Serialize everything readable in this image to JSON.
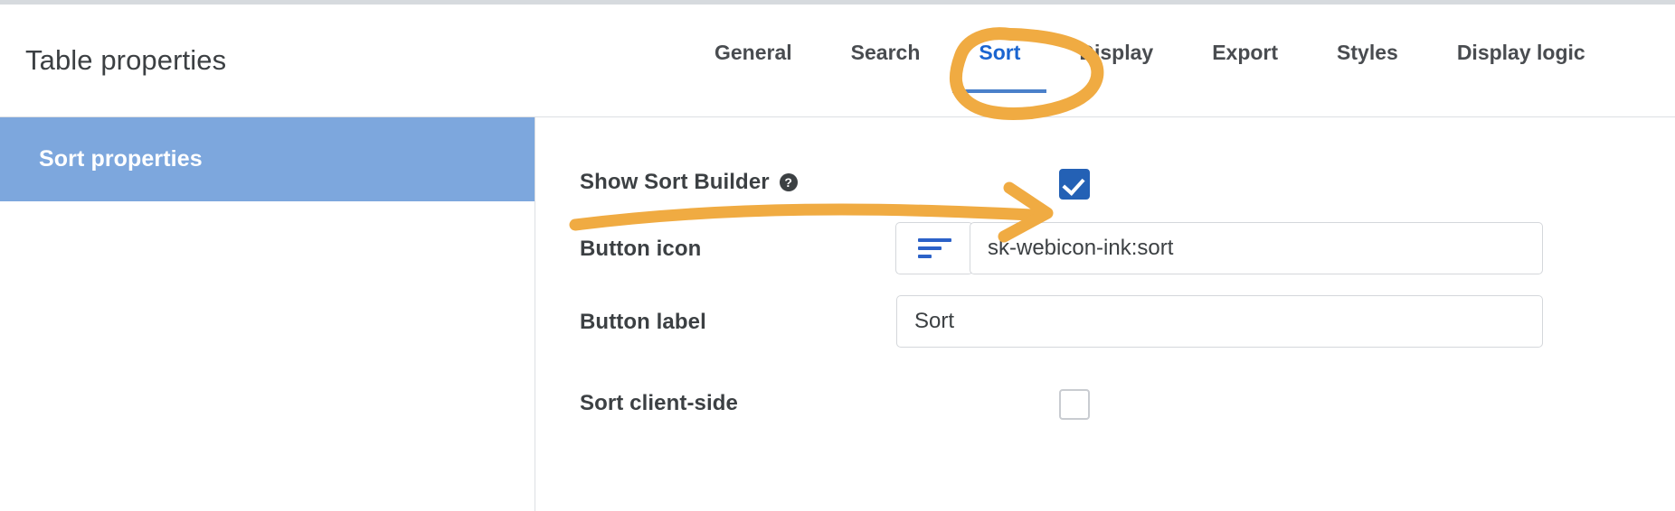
{
  "header": {
    "title": "Table properties",
    "tabs": [
      {
        "label": "General",
        "active": false
      },
      {
        "label": "Search",
        "active": false
      },
      {
        "label": "Sort",
        "active": true
      },
      {
        "label": "Display",
        "active": false
      },
      {
        "label": "Export",
        "active": false
      },
      {
        "label": "Styles",
        "active": false
      },
      {
        "label": "Display logic",
        "active": false
      }
    ]
  },
  "sidebar": {
    "items": [
      {
        "label": "Sort properties",
        "selected": true
      }
    ]
  },
  "form": {
    "rows": [
      {
        "label": "Show Sort Builder",
        "help_icon": "help-circle-icon",
        "control": "checkbox",
        "checked": true
      },
      {
        "label": "Button icon",
        "control": "icon-picker",
        "icon_glyph": "sort-lines-icon",
        "value": "sk-webicon-ink:sort",
        "placeholder": ""
      },
      {
        "label": "Button label",
        "control": "text",
        "value": "Sort",
        "placeholder": ""
      },
      {
        "label": "Sort client-side",
        "control": "checkbox",
        "checked": false
      }
    ]
  },
  "annotations": {
    "circle_target": "Sort",
    "arrow_target": "Show Sort Builder checkbox",
    "color": "#f0ab42"
  },
  "colors": {
    "accent_blue": "#1a65d0",
    "tab_underline": "#4a80ca",
    "sidebar_selected": "#7da7dd",
    "checkbox_checked": "#2461b5",
    "annotation_orange": "#f0ab42",
    "text_primary": "#3c4043",
    "border": "#d4d7db"
  }
}
